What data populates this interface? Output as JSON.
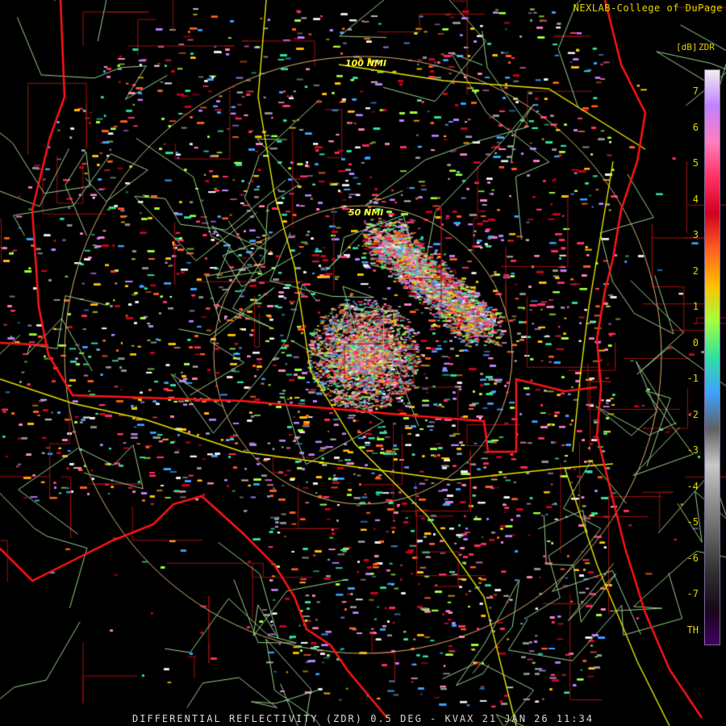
{
  "header": {
    "credit": "NEXLAB-College of DuPage"
  },
  "colors": {
    "state_border": "#ff1414",
    "coastline": "#ff1414",
    "county_line": "#a01010",
    "highway_yellow": "#e6e600",
    "road_green": "#9acd8a",
    "range_ring": "#d8b070",
    "label_yellow": "#ffff30"
  },
  "range_rings": {
    "labels": [
      "100 NMI",
      "50 NMI"
    ]
  },
  "color_scale": {
    "unit": "[dB]",
    "product": "ZDR",
    "ticks": [
      "7",
      "6",
      "5",
      "4",
      "3",
      "2",
      "1",
      "0",
      "-1",
      "-2",
      "-3",
      "-4",
      "-5",
      "-6",
      "-7",
      "TH"
    ],
    "gradient": [
      "#f0f0f0",
      "#c080ff",
      "#ff80c0",
      "#ff3060",
      "#d00020",
      "#ff6020",
      "#ffc000",
      "#a0ff40",
      "#30e0a0",
      "#40a0ff",
      "#606060",
      "#c8c8c8",
      "#909090",
      "#606060",
      "#303030",
      "#180818",
      "#400060"
    ]
  },
  "footer": {
    "product_line": "DIFFERENTIAL REFLECTIVITY (ZDR) 0.5 DEG - KVAX 21 JAN 26 11:34"
  }
}
